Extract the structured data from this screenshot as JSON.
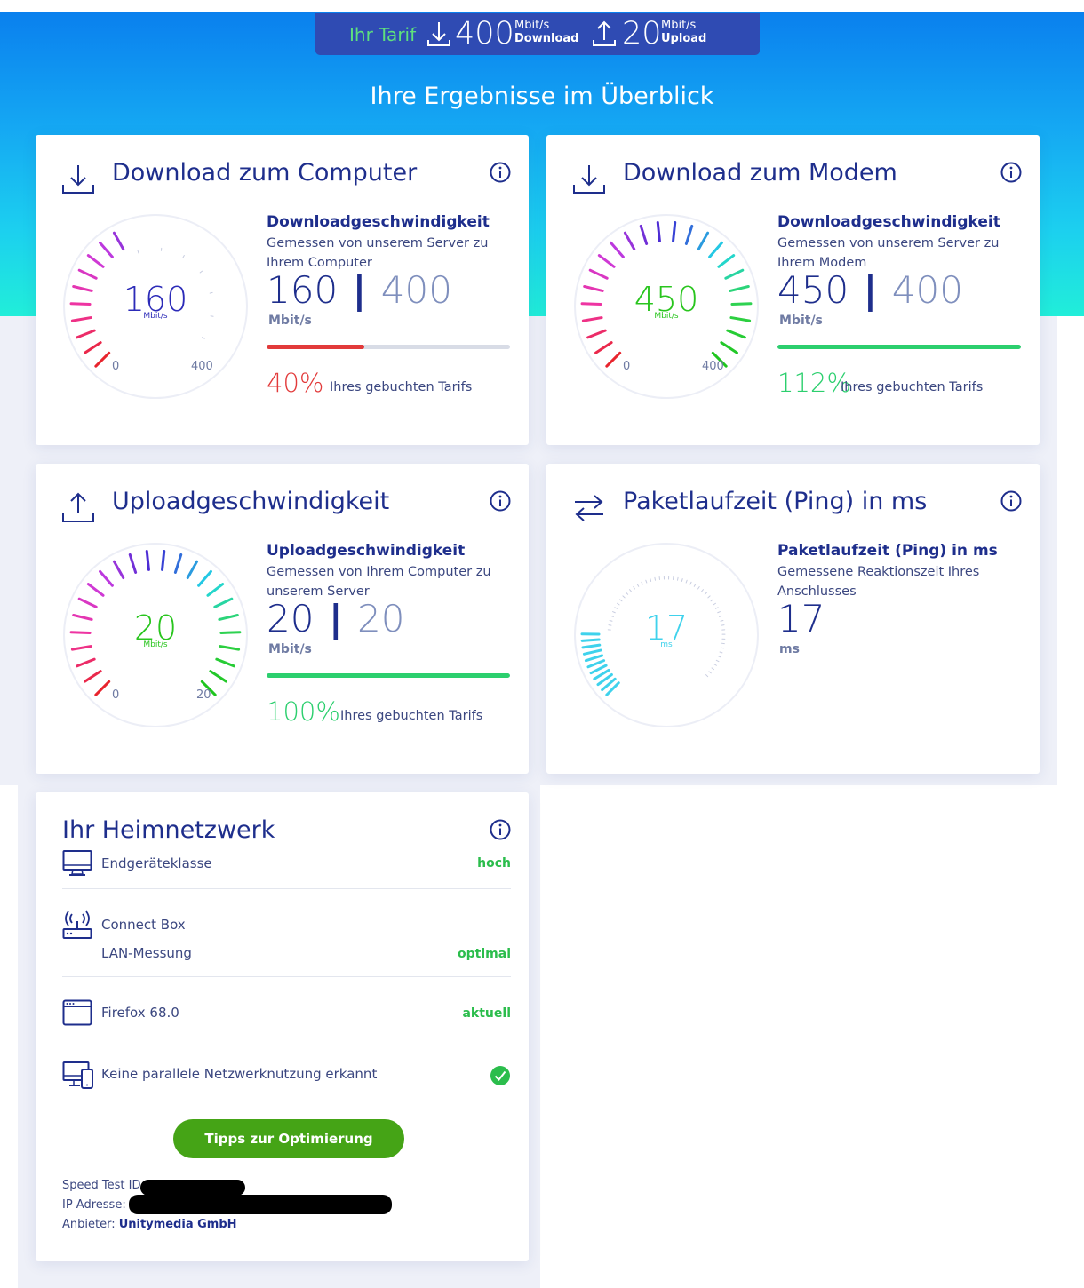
{
  "tariff": {
    "label": "Ihr Tarif",
    "download_value": "400",
    "download_unit": "Mbit/s",
    "download_label": "Download",
    "upload_value": "20",
    "upload_unit": "Mbit/s",
    "upload_label": "Upload"
  },
  "hero": {
    "title": "Ihre Ergebnisse im Überblick"
  },
  "cards": {
    "dl_computer": {
      "title": "Download zum Computer",
      "icon": "download-icon",
      "gauge": {
        "value": "160",
        "unit": "Mbit/s",
        "min": "0",
        "max": "400",
        "fill_fraction": 0.4
      },
      "metric_title": "Downloadgeschwindigkeit",
      "desc": "Gemessen von unserem Server zu Ihrem Computer",
      "measured": "160",
      "tariff": "400",
      "unit": "Mbit/s",
      "percent": "40%",
      "percent_label": "Ihres gebuchten Tarifs",
      "bar_fraction": 0.4,
      "status_color": "#e23a3a",
      "value_color": "#2c2bb8"
    },
    "dl_modem": {
      "title": "Download zum Modem",
      "icon": "download-icon",
      "gauge": {
        "value": "450",
        "unit": "Mbit/s",
        "min": "0",
        "max": "400",
        "fill_fraction": 1.0
      },
      "metric_title": "Downloadgeschwindigkeit",
      "desc": "Gemessen von unserem Server zu Ihrem Modem",
      "measured": "450",
      "tariff": "400",
      "unit": "Mbit/s",
      "percent": "112%",
      "percent_label": "Ihres gebuchten Tarifs",
      "bar_fraction": 1.0,
      "status_color": "#2ccf6e",
      "value_color": "#29c51e"
    },
    "upload": {
      "title": "Uploadgeschwindigkeit",
      "icon": "upload-icon",
      "gauge": {
        "value": "20",
        "unit": "Mbit/s",
        "min": "0",
        "max": "20",
        "fill_fraction": 1.0
      },
      "metric_title": "Uploadgeschwindigkeit",
      "desc": "Gemessen von Ihrem Computer zu unserem Server",
      "measured": "20",
      "tariff": "20",
      "unit": "Mbit/s",
      "percent": "100%",
      "percent_label": "Ihres gebuchten Tarifs",
      "bar_fraction": 1.0,
      "status_color": "#2ccf6e",
      "value_color": "#29c51e"
    },
    "ping": {
      "title": "Paketlaufzeit (Ping) in ms",
      "icon": "ping-arrows-icon",
      "gauge": {
        "value": "17",
        "unit": "ms",
        "fill_fraction": 0.17
      },
      "metric_title": "Paketlaufzeit (Ping) in ms",
      "desc": "Gemessene Reaktionszeit Ihres Anschlusses",
      "measured": "17",
      "unit": "ms",
      "value_color": "#3fd2ec"
    }
  },
  "home": {
    "title": "Ihr Heimnetzwerk",
    "rows": [
      {
        "icon": "monitor-icon",
        "label": "Endgeräteklasse",
        "status": "hoch"
      },
      {
        "icon": "router-icon",
        "label": "Connect Box",
        "sublabel": "LAN-Messung",
        "status": "optimal"
      },
      {
        "icon": "browser-window-icon",
        "label": "Firefox 68.0",
        "status": "aktuell"
      },
      {
        "icon": "devices-icon",
        "label": "Keine parallele Netzwerknutzung erkannt",
        "status_icon": "check-circle-icon"
      }
    ],
    "button": "Tipps zur Optimierung",
    "speedtest_label": "Speed Test ID:",
    "ip_label": "IP Adresse:",
    "provider_label": "Anbieter:",
    "provider": "Unitymedia GmbH"
  },
  "colors": {
    "navy": "#1e2e8c",
    "green_button": "#45a416",
    "status_green": "#2bbd4c"
  }
}
